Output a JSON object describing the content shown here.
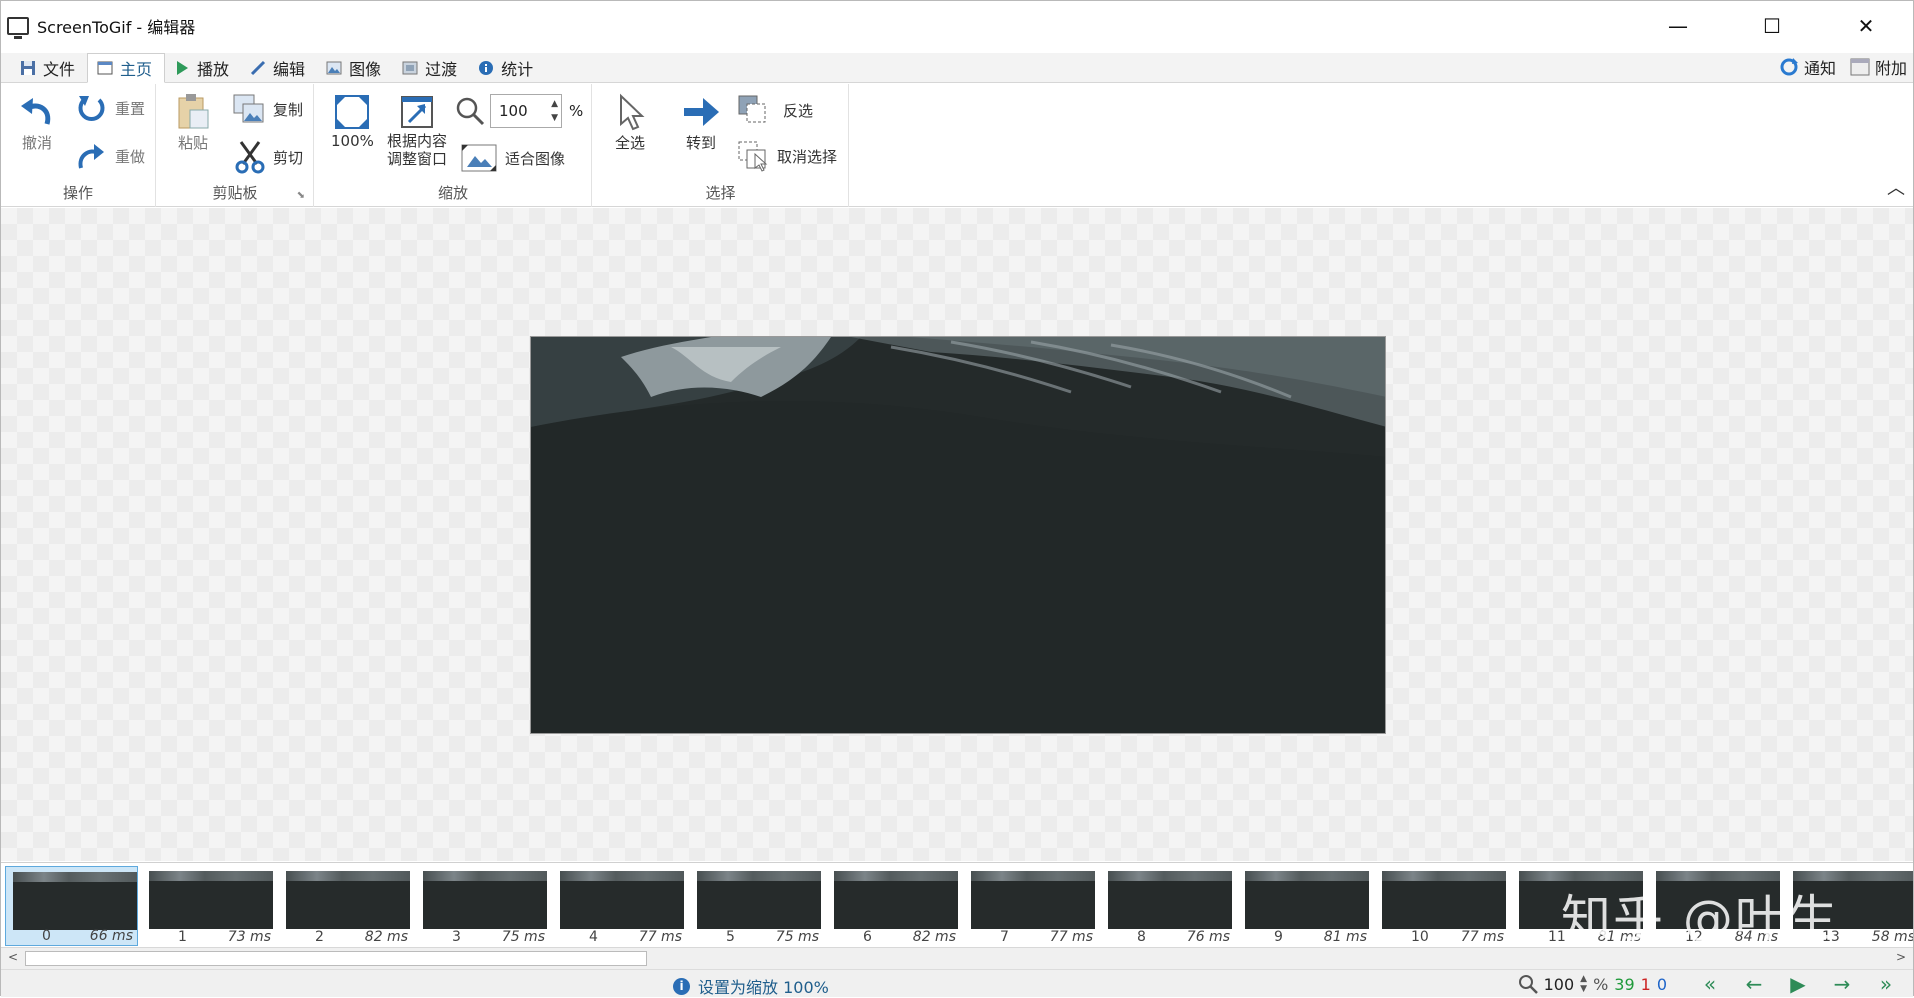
{
  "window": {
    "title": "ScreenToGif - 编辑器",
    "minimize_icon": "minimize-icon",
    "maximize_icon": "maximize-icon",
    "close_icon": "close-icon"
  },
  "tabs": [
    {
      "label": "文件",
      "icon": "save-icon"
    },
    {
      "label": "主页",
      "icon": "home-icon",
      "active": true
    },
    {
      "label": "播放",
      "icon": "play-icon"
    },
    {
      "label": "编辑",
      "icon": "pencil-icon"
    },
    {
      "label": "图像",
      "icon": "image-icon"
    },
    {
      "label": "过渡",
      "icon": "transition-icon"
    },
    {
      "label": "统计",
      "icon": "info-icon"
    }
  ],
  "tabs_right": {
    "notify": "通知",
    "extras": "附加"
  },
  "ribbon": {
    "actions": {
      "label": "操作",
      "undo": "撤消",
      "reset": "重置",
      "redo": "重做"
    },
    "clipboard": {
      "label": "剪贴板",
      "paste": "粘贴",
      "copy": "复制",
      "cut": "剪切"
    },
    "zoom": {
      "label": "缩放",
      "percent100": "100%",
      "fit_line1": "根据内容",
      "fit_line2": "调整窗口",
      "zoom_value": "100",
      "percent_sign": "%",
      "fit_image": "适合图像"
    },
    "select": {
      "label": "选择",
      "select_all": "全选",
      "goto": "转到",
      "invert": "反选",
      "deselect": "取消选择"
    }
  },
  "frames": [
    {
      "index": "0",
      "delay": "66 ms",
      "selected": true
    },
    {
      "index": "1",
      "delay": "73 ms"
    },
    {
      "index": "2",
      "delay": "82 ms"
    },
    {
      "index": "3",
      "delay": "75 ms"
    },
    {
      "index": "4",
      "delay": "77 ms"
    },
    {
      "index": "5",
      "delay": "75 ms"
    },
    {
      "index": "6",
      "delay": "82 ms"
    },
    {
      "index": "7",
      "delay": "77 ms"
    },
    {
      "index": "8",
      "delay": "76 ms"
    },
    {
      "index": "9",
      "delay": "81 ms"
    },
    {
      "index": "10",
      "delay": "77 ms"
    },
    {
      "index": "11",
      "delay": "81 ms"
    },
    {
      "index": "12",
      "delay": "84 ms"
    },
    {
      "index": "13",
      "delay": "58 ms"
    }
  ],
  "status": {
    "message": "设置为缩放 100%",
    "zoom_value": "100",
    "percent_sign": "%",
    "frame_count": "39",
    "selected_count": "1",
    "current_frame": "0"
  },
  "watermark": "知乎 @叶生"
}
